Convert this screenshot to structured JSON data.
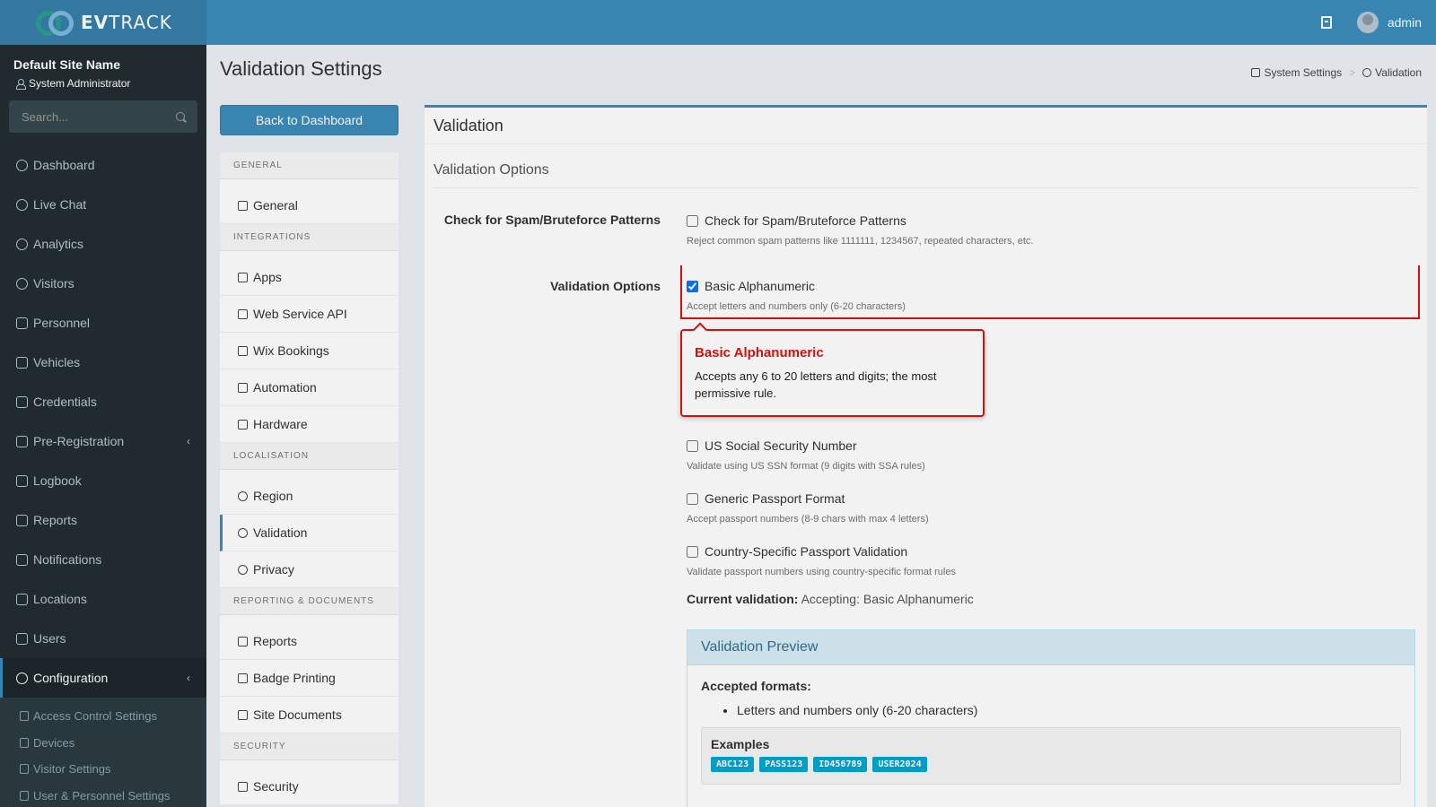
{
  "brand": {
    "name_bold": "EV",
    "name_rest": "TRACK"
  },
  "topbar": {
    "user": "admin"
  },
  "sidebar": {
    "site_name": "Default Site Name",
    "role": "System Administrator",
    "search_placeholder": "Search...",
    "items": [
      {
        "label": "Dashboard",
        "icon": "gauge-icon"
      },
      {
        "label": "Live Chat",
        "icon": "headset-icon"
      },
      {
        "label": "Analytics",
        "icon": "target-icon"
      },
      {
        "label": "Visitors",
        "icon": "eye-icon"
      },
      {
        "label": "Personnel",
        "icon": "user-plus-icon"
      },
      {
        "label": "Vehicles",
        "icon": "car-icon"
      },
      {
        "label": "Credentials",
        "icon": "briefcase-icon"
      },
      {
        "label": "Pre-Registration",
        "icon": "arrows-icon"
      },
      {
        "label": "Logbook",
        "icon": "book-icon"
      },
      {
        "label": "Reports",
        "icon": "chart-icon"
      },
      {
        "label": "Notifications",
        "icon": "chat-icon"
      },
      {
        "label": "Locations",
        "icon": "map-icon"
      },
      {
        "label": "Users",
        "icon": "users-icon"
      },
      {
        "label": "Configuration",
        "icon": "gear-icon"
      }
    ],
    "subitems": [
      {
        "label": "Access Control Settings",
        "icon": "lock-icon"
      },
      {
        "label": "Devices",
        "icon": "chip-icon"
      },
      {
        "label": "Visitor Settings",
        "icon": "eye-icon"
      },
      {
        "label": "User & Personnel Settings",
        "icon": "users-icon"
      }
    ]
  },
  "header": {
    "title": "Validation Settings",
    "breadcrumb": [
      "System Settings",
      "Validation"
    ],
    "breadcrumb_sep": ">"
  },
  "back_button": "Back to Dashboard",
  "settings_menu": {
    "general_header": "GENERAL",
    "general": [
      "General"
    ],
    "integrations_header": "INTEGRATIONS",
    "integrations": [
      "Apps",
      "Web Service API",
      "Wix Bookings",
      "Automation",
      "Hardware"
    ],
    "localisation_header": "LOCALISATION",
    "localisation": [
      "Region",
      "Validation",
      "Privacy"
    ],
    "reporting_header": "REPORTING & DOCUMENTS",
    "reporting": [
      "Reports",
      "Badge Printing",
      "Site Documents"
    ],
    "security_header": "SECURITY",
    "security": [
      "Security"
    ]
  },
  "panel": {
    "title": "Validation",
    "section": "Validation Options",
    "spam_label": "Check for Spam/Bruteforce Patterns",
    "spam_checkbox": "Check for Spam/Bruteforce Patterns",
    "spam_help": "Reject common spam patterns like 1111111, 1234567, repeated characters, etc.",
    "options_label": "Validation Options",
    "options": [
      {
        "label": "Basic Alphanumeric",
        "help": "Accept letters and numbers only (6-20 characters)",
        "checked": true
      },
      {
        "label": "US Social Security Number",
        "help": "Validate using US SSN format (9 digits with SSA rules)",
        "checked": false
      },
      {
        "label": "Generic Passport Format",
        "help": "Accept passport numbers (8-9 chars with max 4 letters)",
        "checked": false
      },
      {
        "label": "Country-Specific Passport Validation",
        "help": "Validate passport numbers using country-specific format rules",
        "checked": false
      }
    ],
    "current_label": "Current validation:",
    "current_value": "Accepting: Basic Alphanumeric"
  },
  "callout": {
    "title": "Basic Alphanumeric",
    "body": "Accepts any 6 to 20 letters and digits; the most permissive rule."
  },
  "preview": {
    "title": "Validation Preview",
    "accepted_label": "Accepted formats:",
    "accepted": [
      "Letters and numbers only (6-20 characters)"
    ],
    "examples_title": "Examples",
    "examples": [
      "ABC123",
      "PASS123",
      "ID456789",
      "USER2024"
    ]
  },
  "colors": {
    "primary": "#3c8dbc",
    "sidebar": "#222d32",
    "highlight": "#dd1111",
    "tag": "#00a7d0"
  }
}
